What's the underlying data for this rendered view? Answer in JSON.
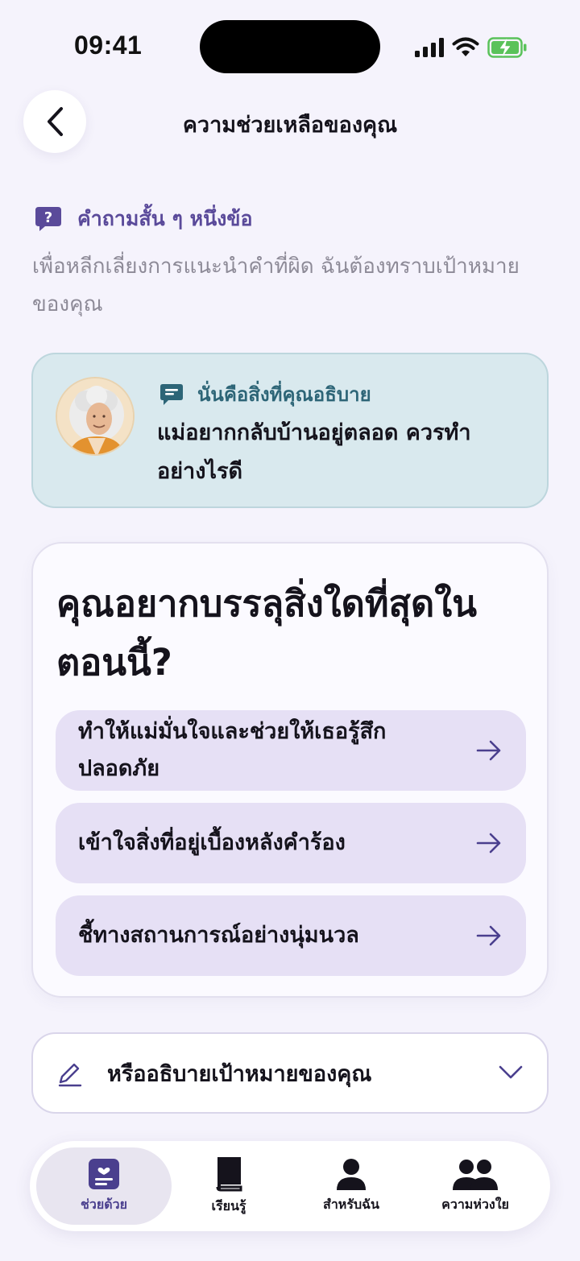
{
  "status_bar": {
    "time": "09:41",
    "icons": [
      "signal-icon",
      "wifi-icon",
      "battery-charging-icon"
    ]
  },
  "header": {
    "title": "ความช่วยเหลือของคุณ",
    "back_icon": "chevron-left-icon"
  },
  "question": {
    "label": "คำถามสั้น ๆ หนึ่งข้อ",
    "description": "เพื่อหลีกเลี่ยงการแนะนำคำที่ผิด ฉันต้องทราบเป้าหมายของคุณ",
    "icon": "question-bubble-icon"
  },
  "said_card": {
    "label": "นั่นคือสิ่งที่คุณอธิบาย",
    "text": "แม่อยากกลับบ้านอยู่ตลอด ควรทำอย่างไรดี",
    "icon": "chat-bubble-icon",
    "avatar": "elderly-woman-avatar"
  },
  "goal_card": {
    "heading": "คุณอยากบรรลุสิ่งใดที่สุดในตอนนี้?",
    "options": [
      {
        "label": "ทำให้แม่มั่นใจและช่วยให้เธอรู้สึกปลอดภัย"
      },
      {
        "label": "เข้าใจสิ่งที่อยู่เบื้องหลังคำร้อง"
      },
      {
        "label": "ชี้ทางสถานการณ์อย่างนุ่มนวล"
      }
    ]
  },
  "describe": {
    "label": "หรืออธิบายเป้าหมายของคุณ",
    "icon": "pencil-icon",
    "chevron": "chevron-down-icon"
  },
  "bottom_nav": {
    "items": [
      {
        "label": "ช่วยด้วย",
        "icon": "help-card-icon",
        "active": true
      },
      {
        "label": "เรียนรู้",
        "icon": "book-icon",
        "active": false
      },
      {
        "label": "สำหรับฉัน",
        "icon": "person-icon",
        "active": false
      },
      {
        "label": "ความห่วงใย",
        "icon": "people-icon",
        "active": false
      }
    ]
  },
  "colors": {
    "background": "#f5f3fc",
    "accent": "#5a4a9a",
    "said_card_bg": "#d9e9ee",
    "option_bg": "#e6e0f5"
  }
}
